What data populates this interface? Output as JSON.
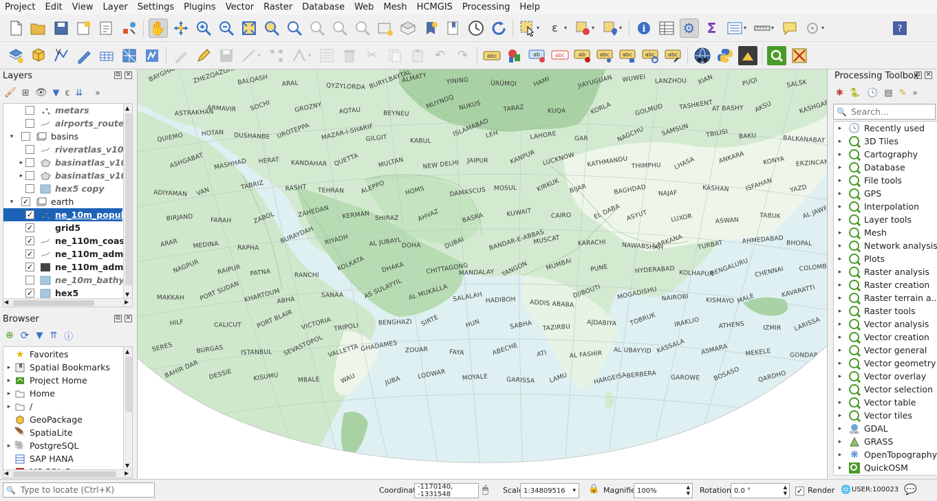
{
  "menu": [
    "Project",
    "Edit",
    "View",
    "Layer",
    "Settings",
    "Plugins",
    "Vector",
    "Raster",
    "Database",
    "Web",
    "Mesh",
    "HCMGIS",
    "Processing",
    "Help"
  ],
  "layers_panel": {
    "title": "Layers",
    "items": [
      {
        "label": "metars",
        "checked": false,
        "indent": 1,
        "style": "italic",
        "icon": "point-layer-icon",
        "expander": ""
      },
      {
        "label": "airports_routes",
        "checked": false,
        "indent": 1,
        "style": "italic",
        "icon": "line-layer-icon",
        "expander": ""
      },
      {
        "label": "basins",
        "checked": false,
        "indent": 0,
        "style": "normal",
        "icon": "group-icon",
        "expander": "▾"
      },
      {
        "label": "riveratlas_v10_si",
        "checked": false,
        "indent": 1,
        "style": "italic",
        "icon": "line-layer-icon",
        "expander": ""
      },
      {
        "label": "basinatlas_v10_l",
        "checked": false,
        "indent": 1,
        "style": "italic",
        "icon": "polygon-group-icon",
        "expander": "▸"
      },
      {
        "label": "basinatlas_v10_l",
        "checked": false,
        "indent": 1,
        "style": "italic",
        "icon": "polygon-group-icon",
        "expander": "▸"
      },
      {
        "label": "hex5 copy",
        "checked": false,
        "indent": 1,
        "style": "italic",
        "icon": "polygon-layer-icon",
        "expander": ""
      },
      {
        "label": "earth",
        "checked": true,
        "indent": 0,
        "style": "normal",
        "icon": "group-icon",
        "expander": "▾"
      },
      {
        "label": "ne_10m_popula",
        "checked": true,
        "indent": 1,
        "style": "selected",
        "icon": "point-layer-icon",
        "expander": ""
      },
      {
        "label": "grid5",
        "checked": true,
        "indent": 1,
        "style": "bold",
        "icon": "none",
        "expander": ""
      },
      {
        "label": "ne_110m_coastl",
        "checked": true,
        "indent": 1,
        "style": "bold",
        "icon": "line-layer-icon",
        "expander": ""
      },
      {
        "label": "ne_110m_admin",
        "checked": true,
        "indent": 1,
        "style": "bold",
        "icon": "line-layer-icon",
        "expander": ""
      },
      {
        "label": "ne_110m_admin",
        "checked": true,
        "indent": 1,
        "style": "bold",
        "icon": "dark-polygon-icon",
        "expander": ""
      },
      {
        "label": "ne_10m_bathym",
        "checked": false,
        "indent": 1,
        "style": "italic",
        "icon": "polygon-layer-icon",
        "expander": ""
      },
      {
        "label": "hex5",
        "checked": true,
        "indent": 1,
        "style": "bold",
        "icon": "polygon-layer-icon",
        "expander": ""
      }
    ]
  },
  "browser_panel": {
    "title": "Browser",
    "items": [
      {
        "label": "Favorites",
        "icon": "star-icon",
        "expander": ""
      },
      {
        "label": "Spatial Bookmarks",
        "icon": "bookmark-icon",
        "expander": "▸"
      },
      {
        "label": "Project Home",
        "icon": "project-home-icon",
        "expander": "▸"
      },
      {
        "label": "Home",
        "icon": "folder-icon",
        "expander": "▸"
      },
      {
        "label": "/",
        "icon": "folder-icon",
        "expander": "▸"
      },
      {
        "label": "GeoPackage",
        "icon": "geopackage-icon",
        "expander": ""
      },
      {
        "label": "SpatiaLite",
        "icon": "spatialite-icon",
        "expander": ""
      },
      {
        "label": "PostgreSQL",
        "icon": "postgresql-icon",
        "expander": "▸"
      },
      {
        "label": "SAP HANA",
        "icon": "saphana-icon",
        "expander": ""
      },
      {
        "label": "MS SQL Server",
        "icon": "mssql-icon",
        "expander": ""
      }
    ]
  },
  "toolbox": {
    "title": "Processing Toolbox",
    "search_placeholder": "Search...",
    "items": [
      {
        "label": "Recently used",
        "icon": "clock-icon"
      },
      {
        "label": "3D Tiles",
        "icon": "processing-icon"
      },
      {
        "label": "Cartography",
        "icon": "processing-icon"
      },
      {
        "label": "Database",
        "icon": "processing-icon"
      },
      {
        "label": "File tools",
        "icon": "processing-icon"
      },
      {
        "label": "GPS",
        "icon": "processing-icon"
      },
      {
        "label": "Interpolation",
        "icon": "processing-icon"
      },
      {
        "label": "Layer tools",
        "icon": "processing-icon"
      },
      {
        "label": "Mesh",
        "icon": "processing-icon"
      },
      {
        "label": "Network analysis",
        "icon": "processing-icon"
      },
      {
        "label": "Plots",
        "icon": "processing-icon"
      },
      {
        "label": "Raster analysis",
        "icon": "processing-icon"
      },
      {
        "label": "Raster creation",
        "icon": "processing-icon"
      },
      {
        "label": "Raster terrain a...",
        "icon": "processing-icon"
      },
      {
        "label": "Raster tools",
        "icon": "processing-icon"
      },
      {
        "label": "Vector analysis",
        "icon": "processing-icon"
      },
      {
        "label": "Vector creation",
        "icon": "processing-icon"
      },
      {
        "label": "Vector general",
        "icon": "processing-icon"
      },
      {
        "label": "Vector geometry",
        "icon": "processing-icon"
      },
      {
        "label": "Vector overlay",
        "icon": "processing-icon"
      },
      {
        "label": "Vector selection",
        "icon": "processing-icon"
      },
      {
        "label": "Vector table",
        "icon": "processing-icon"
      },
      {
        "label": "Vector tiles",
        "icon": "processing-icon"
      },
      {
        "label": "GDAL",
        "icon": "gdal-icon"
      },
      {
        "label": "GRASS",
        "icon": "grass-icon"
      },
      {
        "label": "OpenTopography",
        "icon": "opentopography-icon"
      },
      {
        "label": "QuickOSM",
        "icon": "quickosm-icon"
      }
    ]
  },
  "map_labels": [
    "BAYGHANIN",
    "ZHEZQAZGHAN",
    "BALQASH",
    "ARAL",
    "QYZYLORDA",
    "BURYLBAYTAL",
    "ALMATY",
    "YINING",
    "ÜRÜMQI",
    "HAMI",
    "JIAYUGUAN",
    "WUWEI",
    "LANZHOU",
    "XIAN",
    "PUQI",
    "SALSK",
    "ASTRAKHAN",
    "ARMAVIR",
    "SOCHI",
    "GROZNY",
    "AQTAU",
    "BEYNEU",
    "MUYNOQ",
    "NUKUS",
    "TARAZ",
    "KUQA",
    "KORLA",
    "GOLMUD",
    "TASHKENT",
    "AT BASHY",
    "AKSU",
    "KASHGAR",
    "QUIEMO",
    "HOTAN",
    "DUSHANBE",
    "UROTEPPA",
    "MAZAR-I-SHARIF",
    "GILGIT",
    "KABUL",
    "ISLAMABAD",
    "LEH",
    "LAHORE",
    "GAR",
    "NAGCHU",
    "SAMSUN",
    "TBILISI",
    "BAKU",
    "BALKANABAT",
    "ASHGABAT",
    "MASHHAD",
    "HERAT",
    "KANDAHAR",
    "QUETTA",
    "MULTAN",
    "NEW DELHI",
    "JAIPUR",
    "KANPUR",
    "LUCKNOW",
    "KATHMANDU",
    "THIMPHU",
    "LHASA",
    "ANKARA",
    "KONYA",
    "ERZINCAN",
    "ADIYAMAN",
    "VAN",
    "TABRIZ",
    "RASHT",
    "TEHRAN",
    "ALEPPO",
    "HOMS",
    "DAMASCUS",
    "MOSUL",
    "KIRKUK",
    "BIJAR",
    "BAGHDAD",
    "NAJAF",
    "KASHAN",
    "ISFAHAN",
    "YAZD",
    "BIRJAND",
    "FARAH",
    "ZABOL",
    "ZAHEDAN",
    "KERMAN",
    "SHIRAZ",
    "AHVAZ",
    "BASRA",
    "KUWAIT",
    "CAIRO",
    "EL DABA",
    "ASYUT",
    "LUXOR",
    "ASWAN",
    "TABUK",
    "AL JAWF",
    "ARAR",
    "MEDINA",
    "RAPHA",
    "BURAYDAH",
    "RIYADH",
    "AL JUBAYL",
    "DOHA",
    "DUBAI",
    "BANDAR-E-ABBAS",
    "MUSCAT",
    "KARACHI",
    "NAWABSHAH",
    "LARKANA",
    "TURBAT",
    "AHMEDABAD",
    "BHOPAL",
    "NAGPUR",
    "RAIPUR",
    "PATNA",
    "RANCHI",
    "KOLKATA",
    "DHAKA",
    "CHITTAGONG",
    "MANDALAY",
    "YANGON",
    "MUMBAI",
    "PUNE",
    "HYDERABAD",
    "KOLHAPUR",
    "BENGALURU",
    "CHENNAI",
    "COLOMBO",
    "MAKKAH",
    "PORT SUDAN",
    "KHARTOUM",
    "ABHA",
    "SANAA",
    "AS SULAYYIL",
    "AL MUKALLA",
    "SALALAH",
    "HADIBOH",
    "ADDIS ABABA",
    "DJIBOUTI",
    "MOGADISHU",
    "NAIROBI",
    "KISMAYO",
    "MALE",
    "KAVARATTI",
    "HILF",
    "CALICUT",
    "PORT BLAIR",
    "VICTORIA",
    "TRIPOLI",
    "BENGHAZI",
    "SIRTE",
    "HUN",
    "SABHA",
    "TAZIRBU",
    "AJDABIYA",
    "TOBRUK",
    "IRAKLIO",
    "ATHENS",
    "IZMIR",
    "LARISSA",
    "SERES",
    "BURGAS",
    "ISTANBUL",
    "SEVASTOPOL",
    "VALLETTA",
    "GHADAMES",
    "ZOUAR",
    "FAYA",
    "ABECHE",
    "ATI",
    "AL FASHIR",
    "AL UBAYYID",
    "KASSALA",
    "ASMARA",
    "MEKELE",
    "GONDAR",
    "BAHIR DAR",
    "DESSIE",
    "KISUMU",
    "MBALE",
    "WAU",
    "JUBA",
    "LODWAR",
    "MOYALE",
    "GARISSA",
    "LAMU",
    "HARGEISA",
    "BERBERA",
    "GAROWE",
    "BOSASO",
    "QARDHO"
  ],
  "statusbar": {
    "locate_placeholder": "Type to locate (Ctrl+K)",
    "coordinate_label": "Coordinate",
    "coordinate_value": "-1170140, -1331548",
    "scale_label": "Scale",
    "scale_value": "1:34809516",
    "magnifier_label": "Magnifier",
    "magnifier_value": "100%",
    "rotation_label": "Rotation",
    "rotation_value": "0.0 °",
    "render_label": "Render",
    "render_checked": true,
    "crs_value": "USER:100023"
  },
  "colors": {
    "land_light": "#eef6ea",
    "land_mid": "#d3ead0",
    "land_dark": "#a9d2a4",
    "sea": "#dff0f2",
    "selection": "#1c63b8",
    "processing_green": "#4c9a2a"
  }
}
